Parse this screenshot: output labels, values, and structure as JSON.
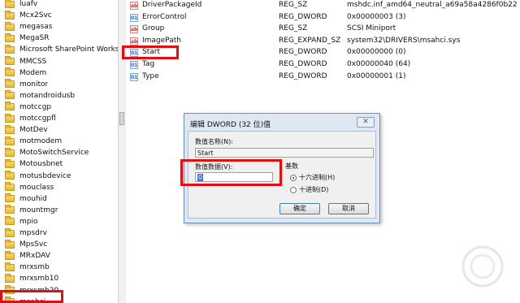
{
  "tree": {
    "items": [
      {
        "label": "luafv"
      },
      {
        "label": "Mcx2Svc"
      },
      {
        "label": "megasas"
      },
      {
        "label": "MegaSR"
      },
      {
        "label": "Microsoft SharePoint Workspa"
      },
      {
        "label": "MMCSS"
      },
      {
        "label": "Modem"
      },
      {
        "label": "monitor"
      },
      {
        "label": "motandroidusb"
      },
      {
        "label": "motccgp"
      },
      {
        "label": "motccgpfl"
      },
      {
        "label": "MotDev"
      },
      {
        "label": "motmodem"
      },
      {
        "label": "MotoSwitchService"
      },
      {
        "label": "Motousbnet"
      },
      {
        "label": "motusbdevice"
      },
      {
        "label": "mouclass"
      },
      {
        "label": "mouhid"
      },
      {
        "label": "mountmgr"
      },
      {
        "label": "mpio"
      },
      {
        "label": "mpsdrv"
      },
      {
        "label": "MpsSvc"
      },
      {
        "label": "MRxDAV"
      },
      {
        "label": "mrxsmb"
      },
      {
        "label": "mrxsmb10"
      },
      {
        "label": "mrxsmb20"
      },
      {
        "label": "msahci"
      }
    ]
  },
  "values": {
    "rows": [
      {
        "name": "DriverPackageId",
        "type": "REG_SZ",
        "data": "mshdc.inf_amd64_neutral_a69a58a4286f0b22",
        "icon": "string-value-icon"
      },
      {
        "name": "ErrorControl",
        "type": "REG_DWORD",
        "data": "0x00000003 (3)",
        "icon": "dword-value-icon"
      },
      {
        "name": "Group",
        "type": "REG_SZ",
        "data": "SCSI Miniport",
        "icon": "string-value-icon"
      },
      {
        "name": "ImagePath",
        "type": "REG_EXPAND_SZ",
        "data": "system32\\DRIVERS\\msahci.sys",
        "icon": "string-value-icon"
      },
      {
        "name": "Start",
        "type": "REG_DWORD",
        "data": "0x00000000 (0)",
        "icon": "dword-value-icon"
      },
      {
        "name": "Tag",
        "type": "REG_DWORD",
        "data": "0x00000040 (64)",
        "icon": "dword-value-icon"
      },
      {
        "name": "Type",
        "type": "REG_DWORD",
        "data": "0x00000001 (1)",
        "icon": "dword-value-icon"
      }
    ]
  },
  "dialog": {
    "title": "编辑 DWORD (32 位)值",
    "close_label": "✕",
    "value_name_label": "数值名称(N):",
    "value_name": "Start",
    "value_data_label": "数值数据(V):",
    "value_data": "0",
    "base_label": "基数",
    "hex_label": "十六进制(H)",
    "dec_label": "十进制(D)",
    "hex_selected": true,
    "ok_label": "确定",
    "cancel_label": "取消"
  },
  "colors": {
    "highlight": "#e01010",
    "dialog_frame": "#dde8f4"
  }
}
